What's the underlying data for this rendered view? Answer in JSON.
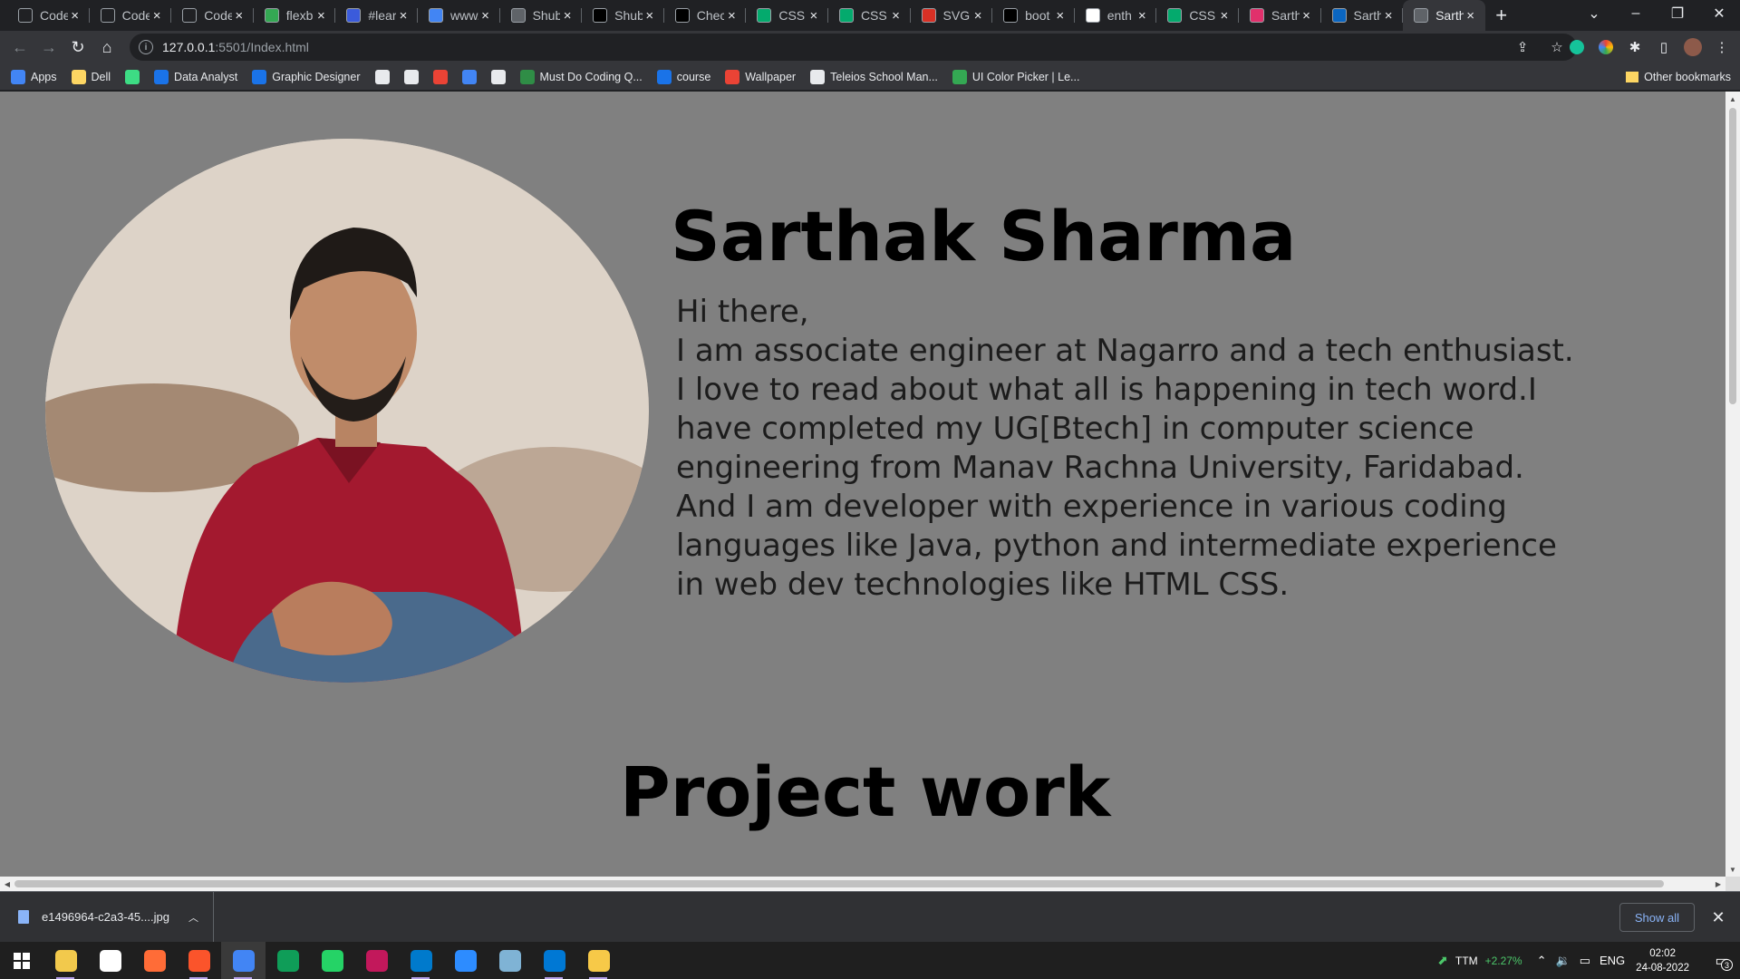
{
  "browser": {
    "tabs": [
      {
        "title": "Code",
        "icon": "square-icon",
        "color": "#202124"
      },
      {
        "title": "Code",
        "icon": "square-icon",
        "color": "#202124"
      },
      {
        "title": "Code",
        "icon": "square-icon",
        "color": "#202124"
      },
      {
        "title": "flexb",
        "icon": "frog-icon",
        "color": "#34a853"
      },
      {
        "title": "#lear",
        "icon": "diamond-icon",
        "color": "#3b5bdb"
      },
      {
        "title": "www.",
        "icon": "code-icon",
        "color": "#4285f4"
      },
      {
        "title": "Shub",
        "icon": "globe-icon",
        "color": "#5f6368"
      },
      {
        "title": "Shub",
        "icon": "github-icon",
        "color": "#000000"
      },
      {
        "title": "Chec",
        "icon": "codepen-icon",
        "color": "#000000"
      },
      {
        "title": "CSS",
        "icon": "w3schools-icon",
        "color": "#04aa6d"
      },
      {
        "title": "CSS",
        "icon": "w3schools-icon",
        "color": "#04aa6d"
      },
      {
        "title": "SVG",
        "icon": "svg-icon",
        "color": "#d93025"
      },
      {
        "title": "boot",
        "icon": "github-icon",
        "color": "#000000"
      },
      {
        "title": "enth",
        "icon": "google-icon",
        "color": "#ffffff"
      },
      {
        "title": "CSS",
        "icon": "w3schools-icon",
        "color": "#04aa6d"
      },
      {
        "title": "Sarth",
        "icon": "instagram-icon",
        "color": "#e1306c"
      },
      {
        "title": "Sarth",
        "icon": "linkedin-icon",
        "color": "#0a66c2"
      },
      {
        "title": "Sarth",
        "icon": "globe-icon",
        "color": "#5f6368",
        "active": true
      }
    ],
    "new_tab": "+",
    "url_host": "127.0.0.1",
    "url_path": ":5501/Index.html",
    "bookmarks": [
      {
        "label": "Apps",
        "icon": "apps-grid-icon",
        "color": "#4285f4"
      },
      {
        "label": "Dell",
        "icon": "folder-icon",
        "color": "#fdd663"
      },
      {
        "label": "",
        "icon": "android-icon",
        "color": "#3ddc84"
      },
      {
        "label": "Data Analyst",
        "icon": "video-icon",
        "color": "#1a73e8"
      },
      {
        "label": "Graphic Designer",
        "icon": "video-icon",
        "color": "#1a73e8"
      },
      {
        "label": "",
        "icon": "globe-icon",
        "color": "#e8eaed"
      },
      {
        "label": "",
        "icon": "mountain-icon",
        "color": "#e8eaed"
      },
      {
        "label": "",
        "icon": "triangle-icon",
        "color": "#ea4335"
      },
      {
        "label": "",
        "icon": "link-icon",
        "color": "#4285f4"
      },
      {
        "label": "",
        "icon": "image-icon",
        "color": "#e8eaed"
      },
      {
        "label": "Must Do Coding Q...",
        "icon": "gfg-icon",
        "color": "#2f8d46"
      },
      {
        "label": "course",
        "icon": "c-icon",
        "color": "#1a73e8"
      },
      {
        "label": "Wallpaper",
        "icon": "flame-icon",
        "color": "#ea4335"
      },
      {
        "label": "Teleios School Man...",
        "icon": "page-icon",
        "color": "#e8eaed"
      },
      {
        "label": "UI Color Picker | Le...",
        "icon": "play-icon",
        "color": "#34a853"
      }
    ],
    "other_bookmarks": "Other bookmarks"
  },
  "page": {
    "name": "Sarthak Sharma",
    "greeting": "Hi there,",
    "bio": "I am associate engineer at Nagarro and a tech enthusiast. I love to read about what all is happening in tech word.I have completed my UG[Btech] in computer science engineering from Manav Rachna University, Faridabad. And I am developer with experience in various coding languages like Java, python and intermediate experience in web dev technologies like HTML CSS.",
    "section_title": "Project work",
    "background_color": "#808080"
  },
  "downloads": {
    "file_name": "e1496964-c2a3-45....jpg",
    "show_all": "Show all"
  },
  "taskbar": {
    "apps": [
      {
        "name": "file-explorer-icon",
        "color": "#f2c94c",
        "running": true
      },
      {
        "name": "mongodb-icon",
        "color": "#ffffff",
        "running": false
      },
      {
        "name": "postman-icon",
        "color": "#ff6c37",
        "running": false
      },
      {
        "name": "brave-icon",
        "color": "#fb542b",
        "running": true
      },
      {
        "name": "chrome-icon",
        "color": "#4285f4",
        "running": true,
        "active": true
      },
      {
        "name": "edge-icon",
        "color": "#0f9d58",
        "running": false
      },
      {
        "name": "whatsapp-icon",
        "color": "#25d366",
        "running": false
      },
      {
        "name": "vector-icon",
        "color": "#c2185b",
        "running": false
      },
      {
        "name": "vscode-icon",
        "color": "#007acc",
        "running": true
      },
      {
        "name": "zoom-icon",
        "color": "#2d8cff",
        "running": false
      },
      {
        "name": "notepad-icon",
        "color": "#7fb3d5",
        "running": false
      },
      {
        "name": "photos-icon",
        "color": "#0078d4",
        "running": true
      },
      {
        "name": "git-icon",
        "color": "#f7c948",
        "running": true
      }
    ],
    "stock": "TTM",
    "stock_change": "+2.27%",
    "language": "ENG",
    "time": "02:02",
    "date": "24-08-2022",
    "notification_count": "3"
  }
}
